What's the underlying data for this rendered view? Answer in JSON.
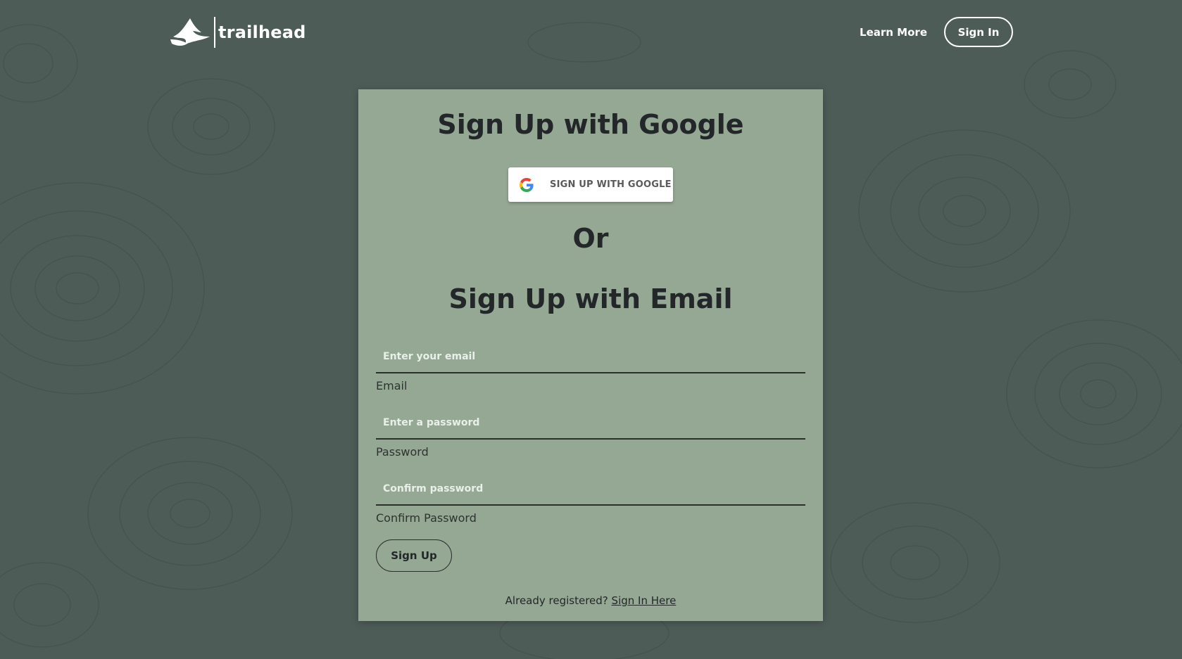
{
  "brand": {
    "name": "trailhead",
    "logo_icon": "mountain-logo-icon"
  },
  "nav": {
    "learn_more": "Learn More",
    "sign_in": "Sign In"
  },
  "card": {
    "google_heading": "Sign Up with Google",
    "google_button": "SIGN UP WITH GOOGLE",
    "google_icon": "google-g-icon",
    "or_heading": "Or",
    "email_heading": "Sign Up with Email",
    "fields": [
      {
        "placeholder": "Enter your email",
        "label": "Email",
        "value": ""
      },
      {
        "placeholder": "Enter a password",
        "label": "Password",
        "value": ""
      },
      {
        "placeholder": "Confirm password",
        "label": "Confirm Password",
        "value": ""
      }
    ],
    "submit": "Sign Up",
    "footer_prompt": "Already registered?",
    "footer_link": "Sign In Here"
  },
  "colors": {
    "background": "#4e5c58",
    "card": "#94a894",
    "text": "#23272a"
  }
}
